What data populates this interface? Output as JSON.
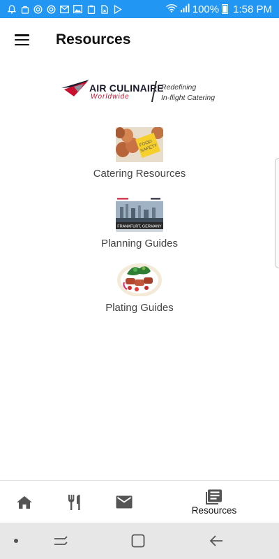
{
  "status_bar": {
    "battery_percent": "100%",
    "time": "1:58 PM",
    "background": "#2196f3"
  },
  "header": {
    "title": "Resources",
    "menu_icon": "hamburger-menu-icon"
  },
  "logo": {
    "name": "AIR CULINAIRE",
    "sub": "Worldwide",
    "tagline_line1": "Redefining",
    "tagline_line2": "In-flight Catering"
  },
  "resources": [
    {
      "label": "Catering Resources",
      "image_text": "FOOD SAFETY"
    },
    {
      "label": "Planning Guides",
      "image_text": "FRANKFURT, GERMANY"
    },
    {
      "label": "Plating Guides"
    }
  ],
  "bottom_nav": {
    "items": [
      {
        "icon": "home-icon"
      },
      {
        "icon": "fork-knife-icon"
      },
      {
        "icon": "mail-icon"
      },
      {
        "icon": "resources-icon",
        "label": "Resources"
      }
    ]
  },
  "system_nav": {
    "items": [
      "dot-icon",
      "recent-apps-icon",
      "home-square-icon",
      "back-arrow-icon"
    ]
  }
}
